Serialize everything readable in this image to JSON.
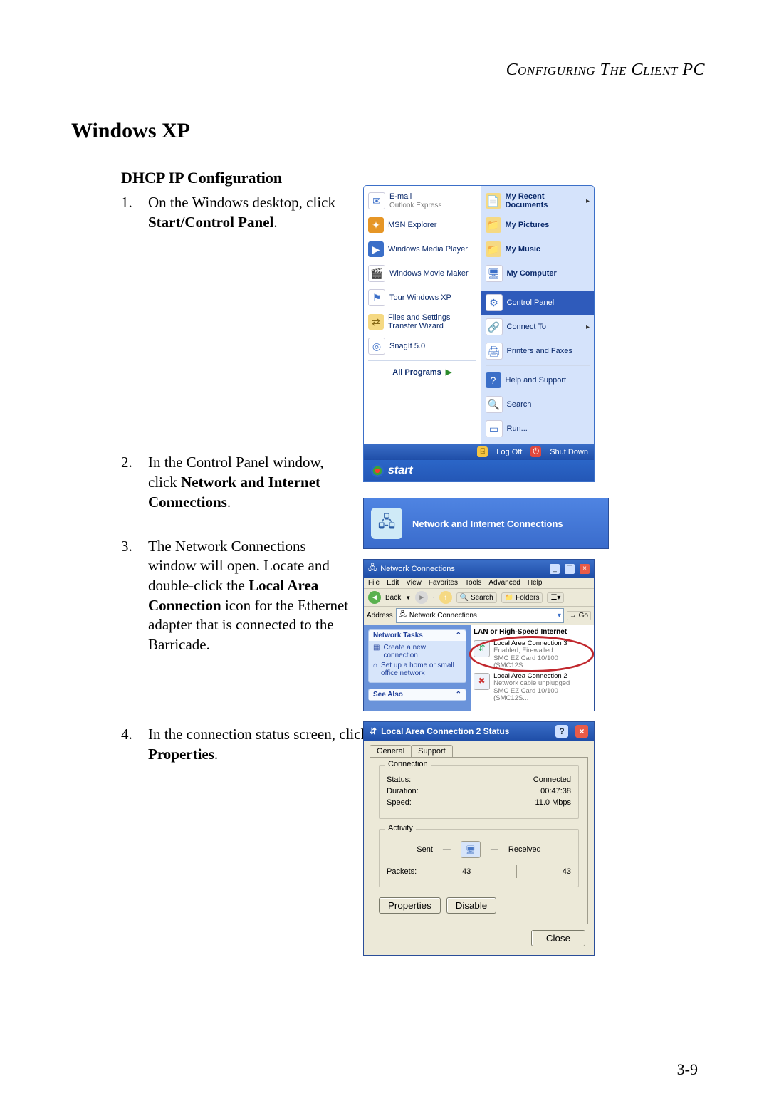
{
  "running_head": "Configuring The Client PC",
  "chapter_heading": "Windows XP",
  "subheading": "DHCP IP Configuration",
  "page_number": "3-9",
  "steps": [
    {
      "num": "1.",
      "pre": "On the Windows desktop, click ",
      "bold": "Start/Control Panel",
      "post": "."
    },
    {
      "num": "2.",
      "pre": "In the Control Panel window, click ",
      "bold": "Network and Internet Connections",
      "post": "."
    },
    {
      "num": "3.",
      "pre": "The Network Connections window will open. Locate and double-click the ",
      "bold": "Local Area Connection",
      "post": " icon for the Ethernet adapter that is connected to the Barricade."
    },
    {
      "num": "4.",
      "pre": "In the connection status screen, click ",
      "bold": "Properties",
      "post": "."
    }
  ],
  "startmenu": {
    "left": [
      {
        "label": "E-mail",
        "sub": "Outlook Express"
      },
      {
        "label": "MSN Explorer"
      },
      {
        "label": "Windows Media Player"
      },
      {
        "label": "Windows Movie Maker"
      },
      {
        "label": "Tour Windows XP"
      },
      {
        "label": "Files and Settings Transfer Wizard"
      },
      {
        "label": "SnagIt 5.0"
      }
    ],
    "all_programs": "All Programs",
    "right": [
      {
        "label": "My Recent Documents",
        "arrow": true
      },
      {
        "label": "My Pictures"
      },
      {
        "label": "My Music"
      },
      {
        "label": "My Computer"
      },
      {
        "label": "Control Panel",
        "highlight": true
      },
      {
        "label": "Connect To",
        "arrow": true
      },
      {
        "label": "Printers and Faxes"
      },
      {
        "label": "Help and Support"
      },
      {
        "label": "Search"
      },
      {
        "label": "Run..."
      }
    ],
    "logoff": "Log Off",
    "shutdown": "Shut Down",
    "start": "start"
  },
  "cp": {
    "link": "Network and Internet Connections"
  },
  "nc": {
    "title": "Network Connections",
    "menus": [
      "File",
      "Edit",
      "View",
      "Favorites",
      "Tools",
      "Advanced",
      "Help"
    ],
    "back": "Back",
    "search": "Search",
    "folders": "Folders",
    "address_label": "Address",
    "address_value": "Network Connections",
    "go": "Go",
    "tasks_header": "Network Tasks",
    "tasks": [
      "Create a new connection",
      "Set up a home or small office network"
    ],
    "seealso": "See Also",
    "group": "LAN or High-Speed Internet",
    "conn1": {
      "name": "Local Area Connection 3",
      "state": "Enabled, Firewalled",
      "nic": "SMC EZ Card 10/100 (SMC12S..."
    },
    "conn2": {
      "name": "Local Area Connection 2",
      "state": "Network cable unplugged",
      "nic": "SMC EZ Card 10/100 (SMC12S..."
    }
  },
  "status": {
    "title": "Local Area Connection 2 Status",
    "tabs": {
      "general": "General",
      "support": "Support"
    },
    "connection_group": "Connection",
    "status_label": "Status:",
    "status_value": "Connected",
    "duration_label": "Duration:",
    "duration_value": "00:47:38",
    "speed_label": "Speed:",
    "speed_value": "11.0 Mbps",
    "activity_group": "Activity",
    "sent": "Sent",
    "received": "Received",
    "packets_label": "Packets:",
    "packets_sent": "43",
    "packets_recv": "43",
    "properties": "Properties",
    "disable": "Disable",
    "close": "Close"
  }
}
